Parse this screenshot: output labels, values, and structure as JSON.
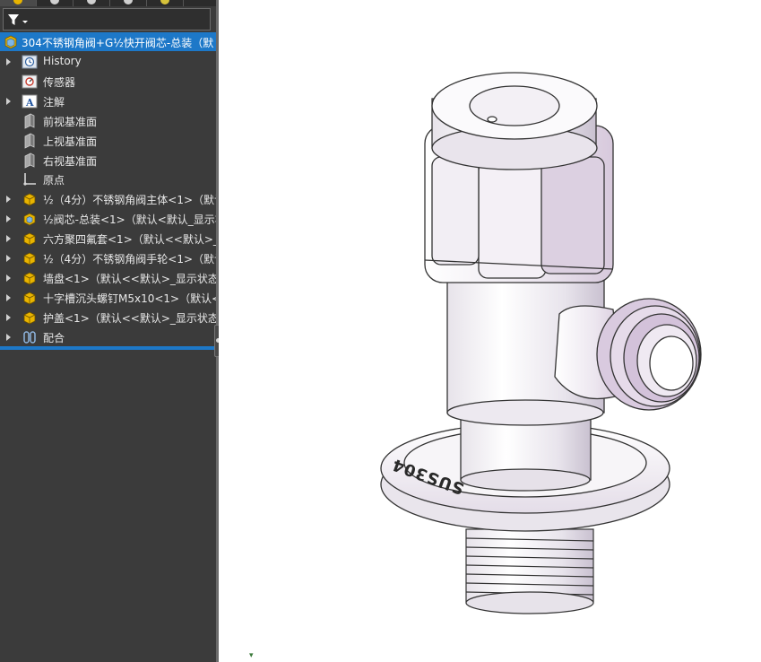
{
  "tree": {
    "root_label": "304不锈钢角阀+G½快开阀芯-总装（默",
    "items": [
      {
        "label": "History",
        "icon": "history-icon",
        "expandable": true
      },
      {
        "label": "传感器",
        "icon": "sensor-icon",
        "expandable": false
      },
      {
        "label": "注解",
        "icon": "annotation-icon",
        "expandable": true
      },
      {
        "label": "前视基准面",
        "icon": "plane-icon",
        "expandable": false
      },
      {
        "label": "上视基准面",
        "icon": "plane-icon",
        "expandable": false
      },
      {
        "label": "右视基准面",
        "icon": "plane-icon",
        "expandable": false
      },
      {
        "label": "原点",
        "icon": "origin-icon",
        "expandable": false
      },
      {
        "label": "½（4分）不锈钢角阀主体<1>（默认",
        "icon": "part-icon",
        "expandable": true
      },
      {
        "label": "½阀芯-总装<1>（默认<默认_显示状",
        "icon": "subassembly-icon",
        "expandable": true
      },
      {
        "label": "六方聚四氟套<1>（默认<<默认>_显",
        "icon": "part-icon",
        "expandable": true
      },
      {
        "label": "½（4分）不锈钢角阀手轮<1>（默认",
        "icon": "part-icon",
        "expandable": true
      },
      {
        "label": "墙盘<1>（默认<<默认>_显示状态",
        "icon": "part-icon",
        "expandable": true
      },
      {
        "label": "十字槽沉头螺钉M5x10<1>（默认<",
        "icon": "part-icon",
        "expandable": true
      },
      {
        "label": "护盖<1>（默认<<默认>_显示状态",
        "icon": "part-icon",
        "expandable": true
      },
      {
        "label": "配合",
        "icon": "mates-icon",
        "expandable": true
      }
    ]
  },
  "model": {
    "engraving": "SUS304"
  },
  "colors": {
    "panel_bg": "#3b3b3b",
    "selection": "#1d78c8",
    "part_yellow": "#e8b400",
    "text": "#e8e8e8"
  }
}
